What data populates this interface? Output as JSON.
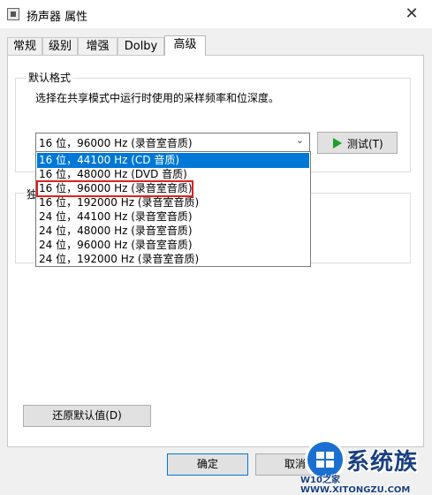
{
  "window": {
    "title": "扬声器 属性",
    "close_glyph": "✕"
  },
  "tabs": [
    {
      "label": "常规"
    },
    {
      "label": "级别"
    },
    {
      "label": "增强"
    },
    {
      "label": "Dolby"
    },
    {
      "label": "高级",
      "active": true
    }
  ],
  "default_format": {
    "group_title": "默认格式",
    "description": "选择在共享模式中运行时使用的采样频率和位深度。",
    "selected_value": "16 位，96000 Hz (录音室音质)",
    "arrow_glyph": "⌄",
    "test_button_label": "测试(T)",
    "options": [
      "16 位，44100 Hz (CD 音质)",
      "16 位，48000 Hz (DVD 音质)",
      "16 位，96000 Hz (录音室音质)",
      "16 位，192000 Hz (录音室音质)",
      "24 位，44100 Hz (录音室音质)",
      "24 位，48000 Hz (录音室音质)",
      "24 位，96000 Hz (录音室音质)",
      "24 位，192000 Hz (录音室音质)"
    ],
    "highlighted_index": 0,
    "red_boxed_index": 2
  },
  "exclusive_mode": {
    "group_title_partial": "独"
  },
  "buttons": {
    "restore_defaults": "还原默认值(D)",
    "ok": "确定",
    "cancel": "取消"
  },
  "watermark": {
    "brand": "系统族",
    "url": "W10之家 WWW.XITONGZU.COM"
  },
  "colors": {
    "selection": "#0078d7",
    "highlight_box": "#e02020",
    "play_icon": "#1e9e2e"
  }
}
